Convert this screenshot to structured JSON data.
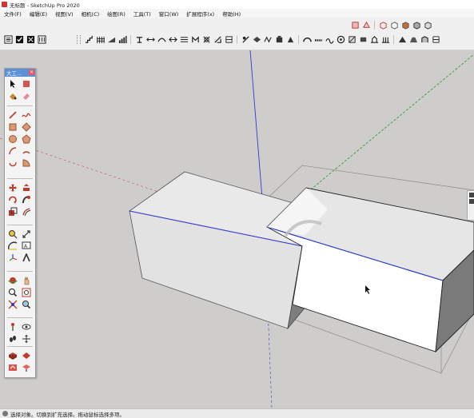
{
  "window": {
    "title": "无标题 - SketchUp Pro 2020"
  },
  "menu": [
    "文件(F)",
    "编辑(E)",
    "视图(V)",
    "相机(C)",
    "绘图(R)",
    "工具(T)",
    "窗口(W)",
    "扩展程序(x)",
    "帮助(H)"
  ],
  "palette": {
    "title": "大工...",
    "close": "×"
  },
  "status": {
    "text": "选择对象。切换到扩充选择。拖动鼠标选择多项。"
  },
  "colors": {
    "accent_red": "#d8322f",
    "axis_red": "#cc2b2b",
    "axis_green": "#2f9e3a",
    "axis_blue": "#2f3ccf",
    "palette_title": "#5b8fd6"
  }
}
